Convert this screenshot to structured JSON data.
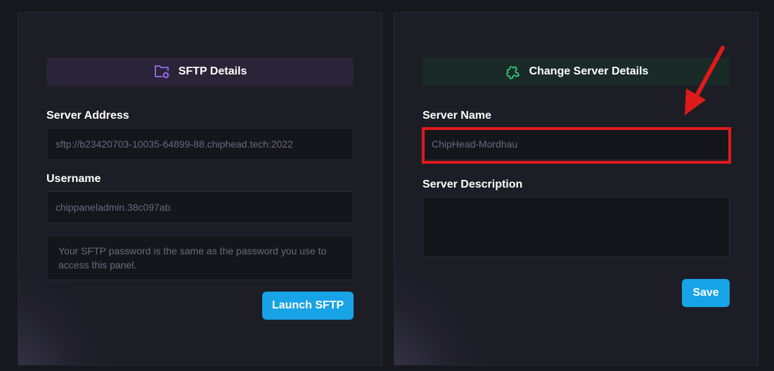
{
  "sftp_card": {
    "header_title": "SFTP Details",
    "header_icon": "folder-gear-icon",
    "server_address_label": "Server Address",
    "server_address_value": "sftp://b23420703-10035-64899-88.chiphead.tech:2022",
    "username_label": "Username",
    "username_value": "chippaneladmin.38c097ab",
    "password_notice": "Your SFTP password is the same as the password you use to access this panel.",
    "launch_button": "Launch SFTP"
  },
  "server_card": {
    "header_title": "Change Server Details",
    "header_icon": "puzzle-icon",
    "server_name_label": "Server Name",
    "server_name_value": "ChipHead-Mordhau",
    "server_description_label": "Server Description",
    "server_description_value": "",
    "save_button": "Save"
  },
  "colors": {
    "background": "#17171e",
    "card": "#1d1d26",
    "accent_button": "#17a3e6",
    "sftp_header": "#2a2438",
    "server_header": "#1a2a26",
    "purple_icon": "#9b6cf0",
    "green_icon": "#2ec97a",
    "annotation_red": "#e01a1a"
  }
}
